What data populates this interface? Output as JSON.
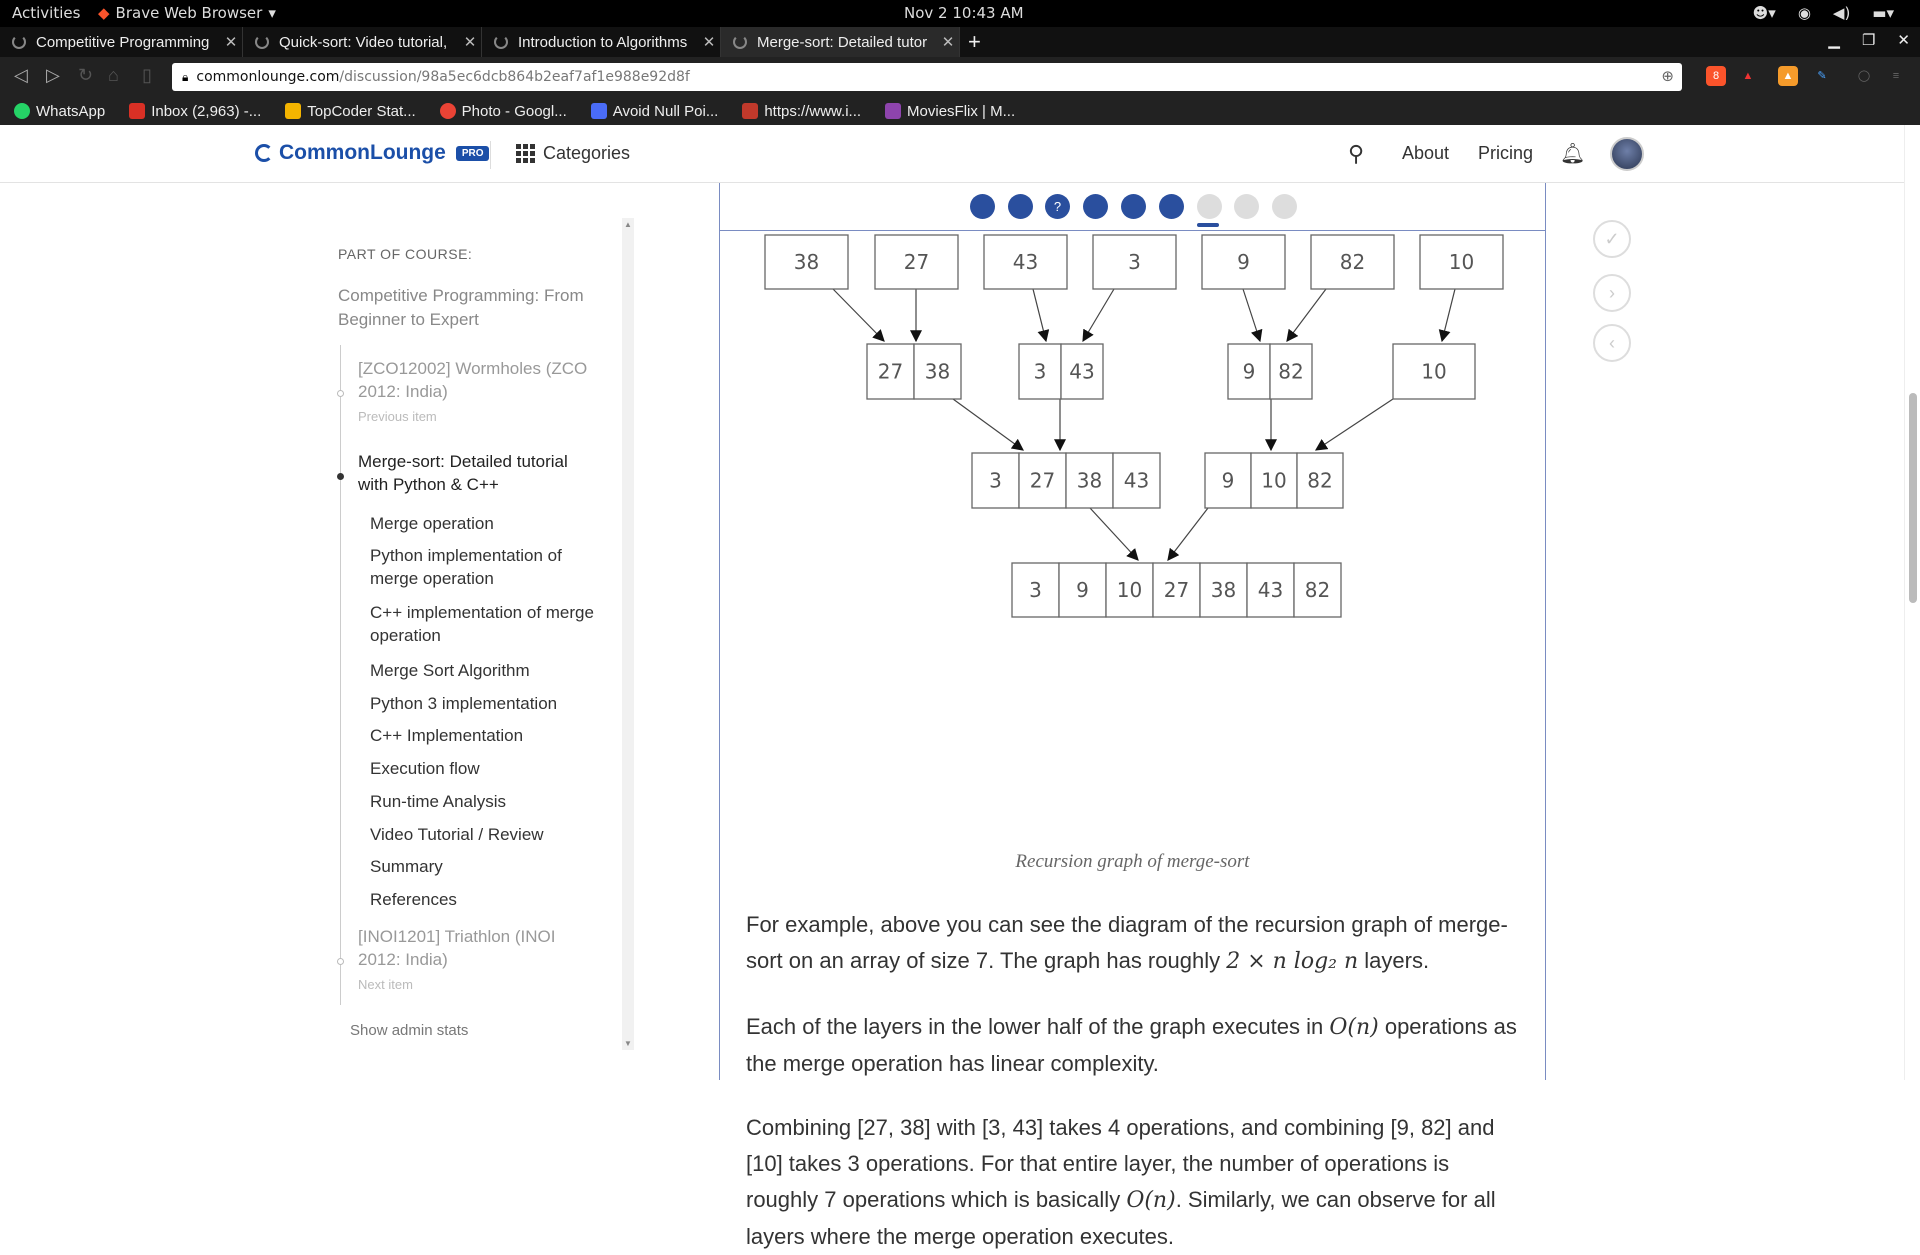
{
  "os": {
    "activities": "Activities",
    "app_name": "Brave Web Browser",
    "clock": "Nov 2  10:43 AM"
  },
  "tabs": [
    {
      "title": "Competitive Programming"
    },
    {
      "title": "Quick-sort: Video tutorial,"
    },
    {
      "title": "Introduction to Algorithms"
    },
    {
      "title": "Merge-sort: Detailed tutor"
    }
  ],
  "address": {
    "host": "commonlounge.com",
    "path": "/discussion/98a5ec6dcb864b2eaf7af1e988e92d8f"
  },
  "bookmarks": [
    {
      "label": "WhatsApp",
      "color": "#25d366"
    },
    {
      "label": "Inbox (2,963) -...",
      "color": "#d93025"
    },
    {
      "label": "TopCoder Stat...",
      "color": "#f4b400"
    },
    {
      "label": "Photo - Googl...",
      "color": "#ea4335"
    },
    {
      "label": "Avoid Null Poi...",
      "color": "#4a6cf7"
    },
    {
      "label": "https://www.i...",
      "color": "#c0392b"
    },
    {
      "label": "MoviesFlix | M...",
      "color": "#8e44ad"
    }
  ],
  "header": {
    "logo": "CommonLounge",
    "pro_badge": "PRO",
    "categories": "Categories",
    "about": "About",
    "pricing": "Pricing"
  },
  "sidebar": {
    "part_of_course": "PART OF COURSE:",
    "course_title": "Competitive Programming: From Beginner to Expert",
    "previous_item": "[ZCO12002] Wormholes (ZCO 2012: India)",
    "previous_label": "Previous item",
    "current_item": "Merge-sort: Detailed tutorial with Python & C++",
    "sections": [
      "Merge operation",
      "Python implementation of merge operation",
      "C++ implementation of merge operation",
      "Merge Sort Algorithm",
      "Python 3 implementation",
      "C++ Implementation",
      "Execution flow",
      "Run-time Analysis",
      "Video Tutorial / Review",
      "Summary",
      "References"
    ],
    "next_item": "[INOI1201] Triathlon (INOI 2012: India)",
    "next_label": "Next item",
    "admin": "Show admin stats"
  },
  "progress": {
    "steps": [
      {
        "state": "done",
        "label": ""
      },
      {
        "state": "done",
        "label": ""
      },
      {
        "state": "done",
        "label": "?"
      },
      {
        "state": "done",
        "label": ""
      },
      {
        "state": "done",
        "label": ""
      },
      {
        "state": "done",
        "label": ""
      },
      {
        "state": "todo",
        "label": ""
      },
      {
        "state": "todo",
        "label": ""
      },
      {
        "state": "todo",
        "label": ""
      }
    ],
    "current_index": 6
  },
  "diagram": {
    "row1": [
      "38",
      "27",
      "43",
      "3",
      "9",
      "82",
      "10"
    ],
    "row2": [
      [
        "27",
        "38"
      ],
      [
        "3",
        "43"
      ],
      [
        "9",
        "82"
      ],
      [
        "10"
      ]
    ],
    "row3": [
      [
        "3",
        "27",
        "38",
        "43"
      ],
      [
        "9",
        "10",
        "82"
      ]
    ],
    "row4": [
      "3",
      "9",
      "10",
      "27",
      "38",
      "43",
      "82"
    ],
    "caption": "Recursion graph of merge-sort"
  },
  "content": {
    "p1_a": "For example, above you can see the diagram of the recursion graph of merge-sort on an array of size 7. The graph has roughly ",
    "p1_math": "2 × n log₂ n",
    "p1_b": " layers.",
    "p2_a": "Each of the layers in the lower half of the graph executes in ",
    "p2_math": "O(n)",
    "p2_b": " operations as the merge operation has linear complexity.",
    "p3_a": "Combining [27, 38] with [3, 43] takes 4 operations, and combining [9, 82] and [10] takes 3 operations. For that entire layer, the number of operations is roughly 7 operations which is basically ",
    "p3_math": "O(n)",
    "p3_b": ". Similarly, we can observe for all layers where the merge operation executes."
  }
}
